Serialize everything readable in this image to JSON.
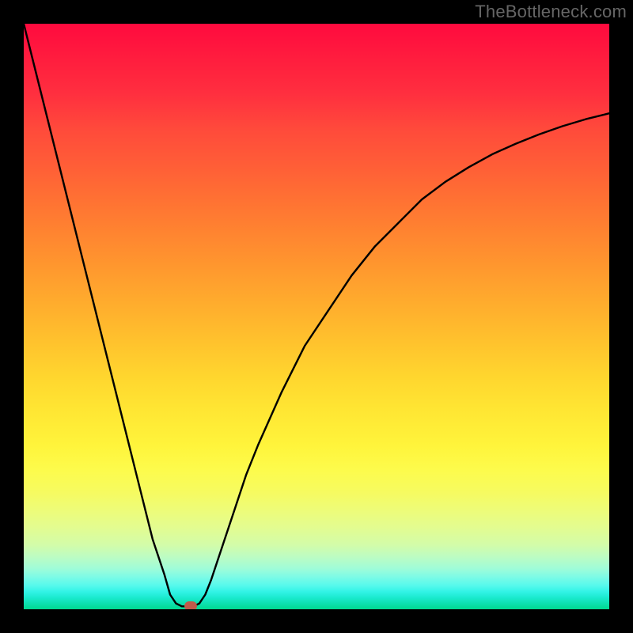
{
  "watermark": "TheBottleneck.com",
  "chart_data": {
    "type": "line",
    "title": "",
    "xlabel": "",
    "ylabel": "",
    "xlim": [
      0,
      100
    ],
    "ylim": [
      0,
      100
    ],
    "grid": false,
    "legend": false,
    "series": [
      {
        "name": "curve",
        "x": [
          0,
          2,
          4,
          6,
          8,
          10,
          12,
          14,
          16,
          18,
          20,
          22,
          24,
          25,
          26,
          27,
          28,
          29,
          30,
          31,
          32,
          34,
          36,
          38,
          40,
          44,
          48,
          52,
          56,
          60,
          64,
          68,
          72,
          76,
          80,
          84,
          88,
          92,
          96,
          100
        ],
        "y": [
          100,
          92,
          84,
          76,
          68,
          60,
          52,
          44,
          36,
          28,
          20,
          12,
          6,
          2.5,
          1,
          0.5,
          0.5,
          0.5,
          1,
          2.5,
          5,
          11,
          17,
          23,
          28,
          37,
          45,
          51,
          57,
          62,
          66,
          70,
          73,
          75.5,
          77.7,
          79.5,
          81.1,
          82.5,
          83.7,
          84.7
        ]
      }
    ],
    "marker": {
      "x": 28.5,
      "y": 0.5,
      "color": "#bf5a4a"
    },
    "gradient": "vertical-rainbow"
  }
}
